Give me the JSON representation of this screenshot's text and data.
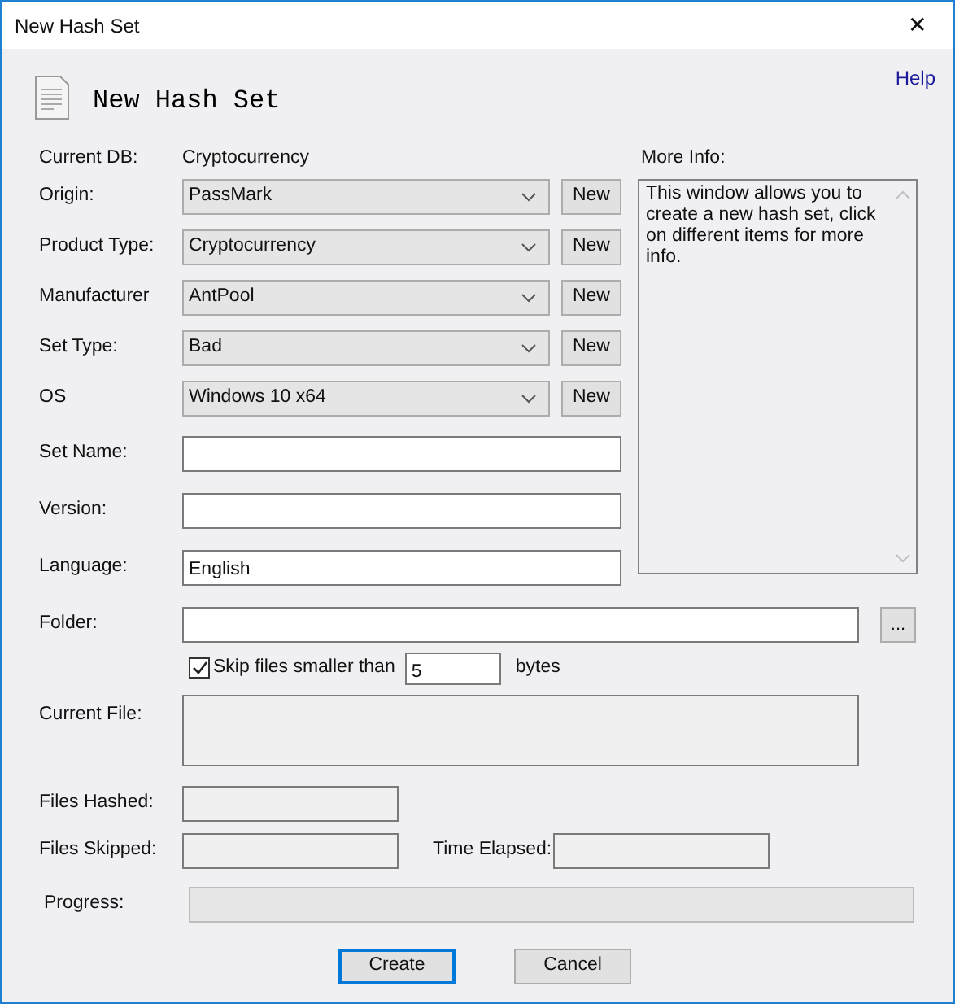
{
  "window": {
    "title": "New Hash Set",
    "close": "✕"
  },
  "header": {
    "title": "New Hash Set",
    "help_link": "Help"
  },
  "current_db": {
    "label": "Current DB:",
    "value": "Cryptocurrency"
  },
  "dropdowns": [
    {
      "label": "Origin:",
      "value": "PassMark",
      "button": "New"
    },
    {
      "label": "Product Type:",
      "value": "Cryptocurrency",
      "button": "New"
    },
    {
      "label": "Manufacturer",
      "value": "AntPool",
      "button": "New"
    },
    {
      "label": "Set Type:",
      "value": "Bad",
      "button": "New"
    },
    {
      "label": "OS",
      "value": "Windows 10 x64",
      "button": "New"
    }
  ],
  "text_fields": [
    {
      "label": "Set Name:"
    },
    {
      "label": "Version:"
    },
    {
      "label": "Language:",
      "value": "English"
    }
  ],
  "more_info": {
    "label": "More Info:",
    "text": "This window allows you to create a new hash set, click on different items for more info."
  },
  "folder": {
    "label": "Folder:",
    "browse_button": "..."
  },
  "skip_small": {
    "label": "Skip files smaller than",
    "checked": true,
    "value": "5",
    "unit": "bytes"
  },
  "current_file": {
    "label": "Current File:"
  },
  "files_hashed": {
    "label": "Files Hashed:"
  },
  "files_skipped": {
    "label": "Files Skipped:"
  },
  "time_elapsed": {
    "label": "Time Elapsed:"
  },
  "progress": {
    "label": "Progress:",
    "level": 0
  },
  "buttons": [
    {
      "label": "Create",
      "default": true
    },
    {
      "label": "Cancel",
      "default": false
    }
  ]
}
